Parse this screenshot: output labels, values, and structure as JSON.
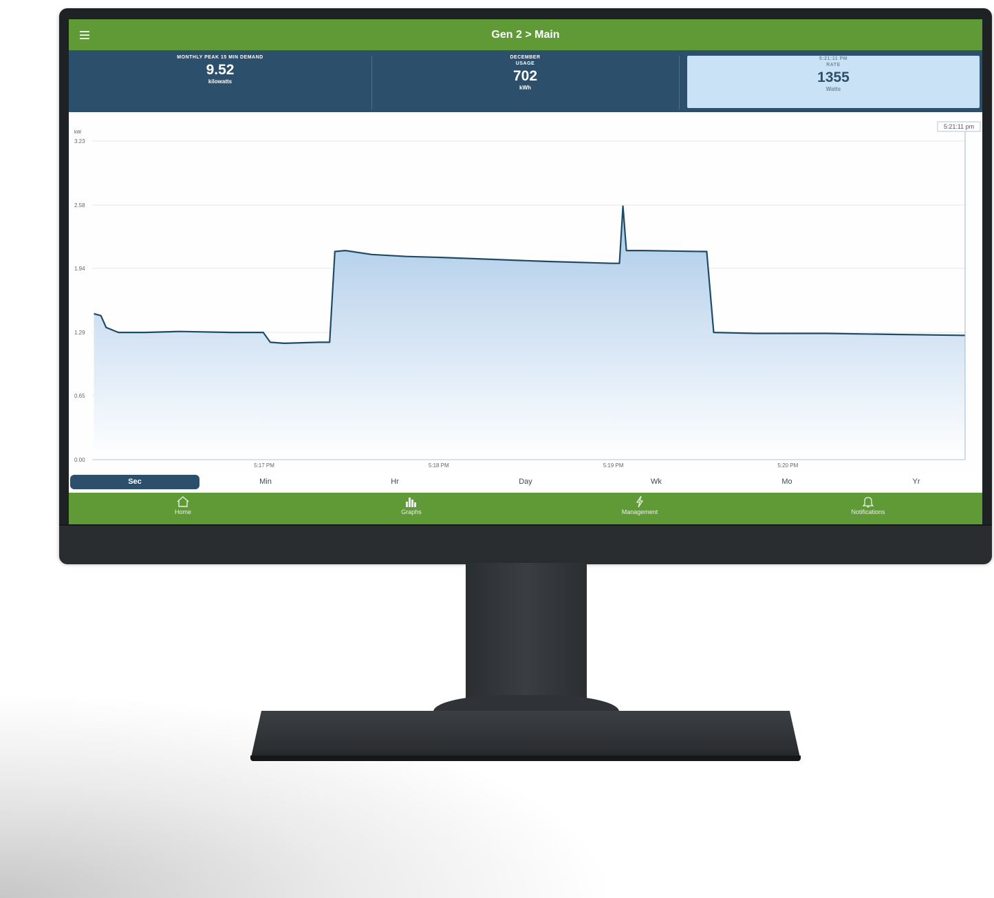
{
  "app": {
    "title": "Gen 2 > Main"
  },
  "stats": [
    {
      "label_1": "MONTHLY PEAK 15 MIN DEMAND",
      "label_2": "",
      "value": "9.52",
      "unit": "kilowatts"
    },
    {
      "label_1": "DECEMBER",
      "label_2": "USAGE",
      "value": "702",
      "unit": "kWh"
    },
    {
      "label_1": "5:21:11 PM",
      "label_2": "RATE",
      "value": "1355",
      "unit": "Watts"
    }
  ],
  "timeframes": [
    "Sec",
    "Min",
    "Hr",
    "Day",
    "Wk",
    "Mo",
    "Yr"
  ],
  "active_timeframe": "Sec",
  "nav": [
    {
      "label": "Home",
      "icon": "home-icon"
    },
    {
      "label": "Graphs",
      "icon": "graphs-icon"
    },
    {
      "label": "Management",
      "icon": "lightning-icon"
    },
    {
      "label": "Notifications",
      "icon": "bell-icon"
    }
  ],
  "colors": {
    "green": "#5f9a36",
    "navy": "#2c506b",
    "active_tile": "#c9e2f6",
    "line": "#1f4a66",
    "fill_top": "#a9c9e8"
  },
  "chart_data": {
    "type": "area",
    "ylabel": "kW",
    "yticks": [
      "0.00",
      "0.65",
      "1.29",
      "1.94",
      "2.58",
      "3.23"
    ],
    "ylim": [
      0,
      3.23
    ],
    "xticks": [
      {
        "label": "5:17 PM",
        "x": 0.985
      },
      {
        "label": "5:18 PM",
        "x": 1.985
      },
      {
        "label": "5:19 PM",
        "x": 2.985
      },
      {
        "label": "5:20 PM",
        "x": 3.985
      }
    ],
    "xlim": [
      0,
      5.0
    ],
    "x_unit": "minutes after 5:16 PM",
    "cursor_label": "5:21:11 pm",
    "grid": true,
    "series": [
      {
        "points": [
          [
            0.01,
            1.48
          ],
          [
            0.05,
            1.46
          ],
          [
            0.08,
            1.34
          ],
          [
            0.15,
            1.29
          ],
          [
            0.3,
            1.29
          ],
          [
            0.5,
            1.3
          ],
          [
            0.8,
            1.29
          ],
          [
            0.98,
            1.29
          ],
          [
            1.02,
            1.19
          ],
          [
            1.1,
            1.18
          ],
          [
            1.3,
            1.19
          ],
          [
            1.36,
            1.19
          ],
          [
            1.39,
            2.11
          ],
          [
            1.45,
            2.12
          ],
          [
            1.6,
            2.08
          ],
          [
            1.8,
            2.06
          ],
          [
            2.0,
            2.05
          ],
          [
            2.3,
            2.03
          ],
          [
            2.6,
            2.01
          ],
          [
            2.98,
            1.99
          ],
          [
            2.99,
            1.99
          ],
          [
            3.02,
            1.99
          ],
          [
            3.04,
            2.57
          ],
          [
            3.06,
            2.12
          ],
          [
            3.15,
            2.12
          ],
          [
            3.5,
            2.11
          ],
          [
            3.52,
            2.11
          ],
          [
            3.56,
            1.29
          ],
          [
            3.8,
            1.28
          ],
          [
            4.2,
            1.28
          ],
          [
            4.6,
            1.27
          ],
          [
            5.0,
            1.26
          ]
        ]
      }
    ]
  }
}
